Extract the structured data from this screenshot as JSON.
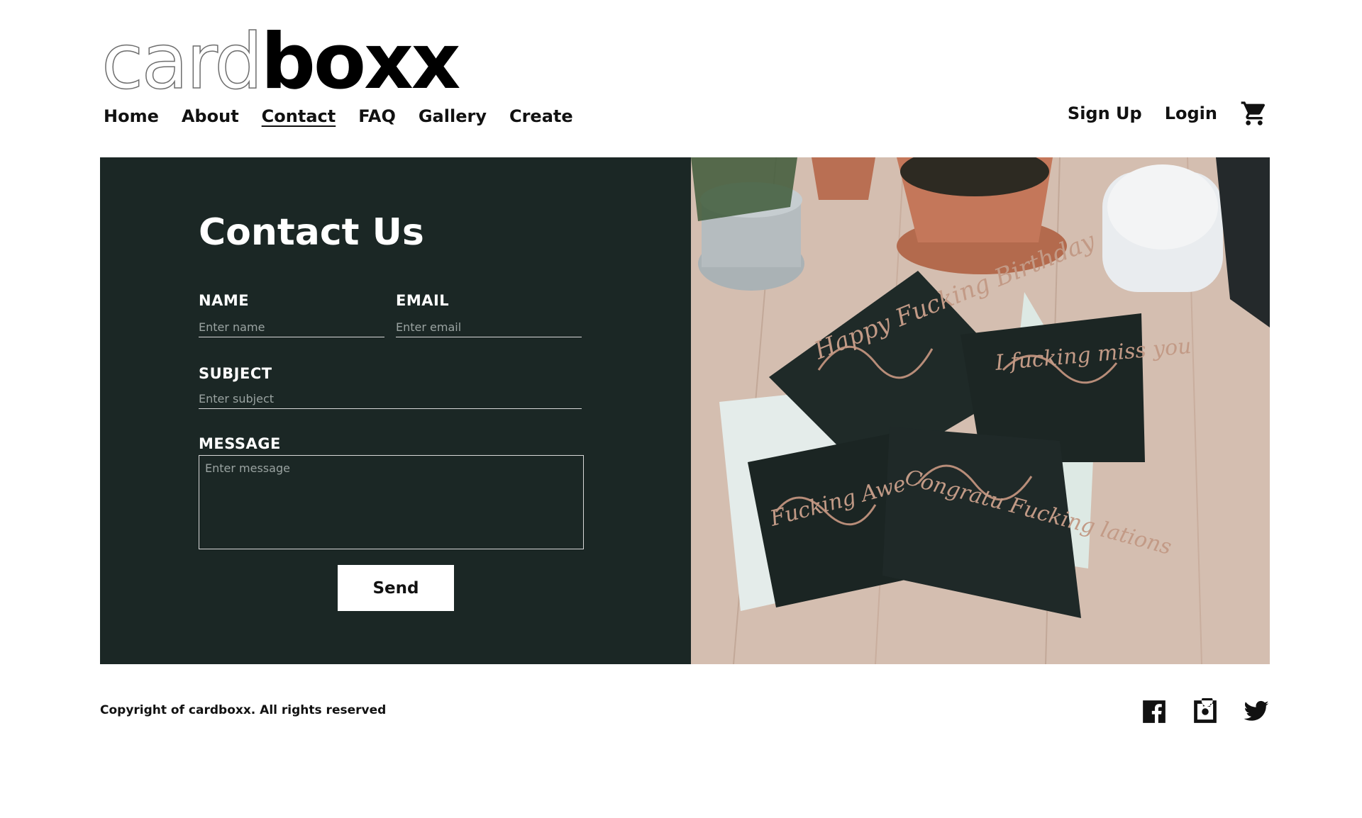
{
  "logo": {
    "outline_text": "card",
    "bold_text": "boxx"
  },
  "nav": {
    "items": [
      {
        "label": "Home"
      },
      {
        "label": "About"
      },
      {
        "label": "Contact",
        "active": true
      },
      {
        "label": "FAQ"
      },
      {
        "label": "Gallery"
      },
      {
        "label": "Create"
      }
    ]
  },
  "auth": {
    "signup": "Sign Up",
    "login": "Login",
    "cart_icon": "shopping-cart-icon"
  },
  "contact": {
    "title": "Contact Us",
    "name_label": "NAME",
    "name_placeholder": "Enter name",
    "email_label": "EMAIL",
    "email_placeholder": "Enter email",
    "subject_label": "SUBJECT",
    "subject_placeholder": "Enter subject",
    "message_label": "MESSAGE",
    "message_placeholder": "Enter message",
    "send_label": "Send"
  },
  "photo": {
    "card_texts": [
      "Happy Fucking Birthday",
      "I fucking miss you",
      "Congratu Fucking lations",
      "Fucking Awe"
    ]
  },
  "footer": {
    "copyright": "Copyright of cardboxx. All rights reserved",
    "social_icons": [
      "facebook-icon",
      "instagram-icon",
      "twitter-icon"
    ]
  },
  "colors": {
    "panel_bg": "#1b2725",
    "text_dark": "#111111",
    "white": "#ffffff"
  }
}
